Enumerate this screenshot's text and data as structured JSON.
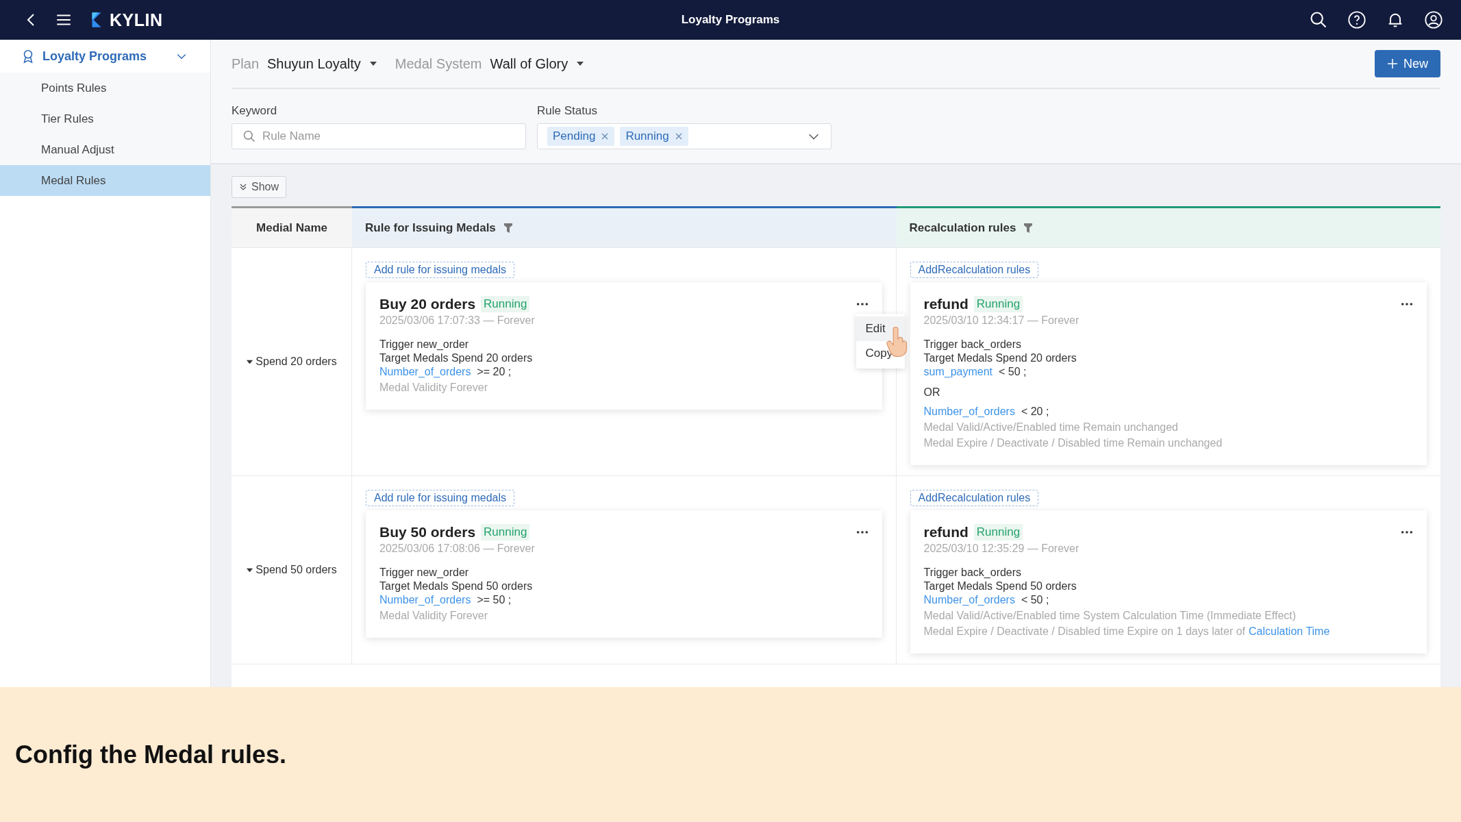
{
  "topbar": {
    "logo": "KYLIN",
    "title": "Loyalty Programs"
  },
  "sidebar": {
    "header": {
      "label": "Loyalty Programs",
      "expanded": true
    },
    "items": [
      {
        "label": "Points Rules",
        "selected": false
      },
      {
        "label": "Tier Rules",
        "selected": false
      },
      {
        "label": "Manual Adjust",
        "selected": false
      },
      {
        "label": "Medal Rules",
        "selected": true
      }
    ]
  },
  "header": {
    "plan_label": "Plan",
    "plan_value": "Shuyun Loyalty",
    "system_label": "Medal System",
    "system_value": "Wall of Glory",
    "new_button": "New"
  },
  "filters": {
    "keyword": {
      "label": "Keyword",
      "placeholder": "Rule Name"
    },
    "status": {
      "label": "Rule Status",
      "tags": [
        "Pending",
        "Running"
      ]
    }
  },
  "show_button": "Show",
  "table": {
    "columns": [
      {
        "label": "Medial Name",
        "filter": false,
        "color": "#9a9a9a"
      },
      {
        "label": "Rule for Issuing Medals",
        "filter": true,
        "color": "#2c6ab5"
      },
      {
        "label": "Recalculation rules",
        "filter": true,
        "color": "#1f9a78"
      }
    ],
    "rows": [
      {
        "name": "Spend 20 orders",
        "expanded": true,
        "issue": {
          "add_link": "Add rule for issuing medals",
          "card": {
            "title": "Buy 20 orders",
            "status": "Running",
            "period": "2025/03/06 17:07:33 — Forever",
            "menu": [
              {
                "label": "Edit",
                "selected": true
              },
              {
                "label": "Copy",
                "selected": false
              }
            ],
            "lines": [
              {
                "kind": "plain",
                "text": "Trigger new_order"
              },
              {
                "kind": "plain",
                "text": "Target Medals Spend 20 orders"
              },
              {
                "kind": "condition",
                "field": "Number_of_orders",
                "expr": ">= 20 ;"
              },
              {
                "kind": "note",
                "text": "Medal Validity Forever"
              }
            ]
          }
        },
        "recalc": {
          "add_link": "AddRecalculation rules",
          "card": {
            "title": "refund",
            "status": "Running",
            "period": "2025/03/10 12:34:17 — Forever",
            "lines": [
              {
                "kind": "plain",
                "text": "Trigger back_orders"
              },
              {
                "kind": "plain",
                "text": "Target Medals Spend 20 orders"
              },
              {
                "kind": "condition",
                "field": "sum_payment",
                "expr": "< 50 ;"
              },
              {
                "kind": "or",
                "text": "OR"
              },
              {
                "kind": "condition",
                "field": "Number_of_orders",
                "expr": "< 20 ;"
              },
              {
                "kind": "note",
                "text": "Medal Valid/Active/Enabled time Remain unchanged"
              },
              {
                "kind": "note",
                "text": "Medal Expire / Deactivate / Disabled time Remain unchanged"
              }
            ]
          }
        }
      },
      {
        "name": "Spend 50 orders",
        "expanded": true,
        "issue": {
          "add_link": "Add rule for issuing medals",
          "card": {
            "title": "Buy 50 orders",
            "status": "Running",
            "period": "2025/03/06 17:08:06 — Forever",
            "lines": [
              {
                "kind": "plain",
                "text": "Trigger new_order"
              },
              {
                "kind": "plain",
                "text": "Target Medals Spend 50 orders"
              },
              {
                "kind": "condition",
                "field": "Number_of_orders",
                "expr": ">= 50 ;"
              },
              {
                "kind": "note",
                "text": "Medal Validity Forever"
              }
            ]
          }
        },
        "recalc": {
          "add_link": "AddRecalculation rules",
          "card": {
            "title": "refund",
            "status": "Running",
            "period": "2025/03/10 12:35:29 — Forever",
            "lines": [
              {
                "kind": "plain",
                "text": "Trigger back_orders"
              },
              {
                "kind": "plain",
                "text": "Target Medals Spend 50 orders"
              },
              {
                "kind": "condition",
                "field": "Number_of_orders",
                "expr": "< 50 ;"
              },
              {
                "kind": "note",
                "text": "Medal Valid/Active/Enabled time System Calculation Time (Immediate Effect)"
              },
              {
                "kind": "note",
                "text": "Medal Expire / Deactivate / Disabled time Expire on 1 days later of",
                "link": "Calculation Time"
              }
            ]
          }
        }
      }
    ]
  },
  "caption": "Config the Medal rules."
}
